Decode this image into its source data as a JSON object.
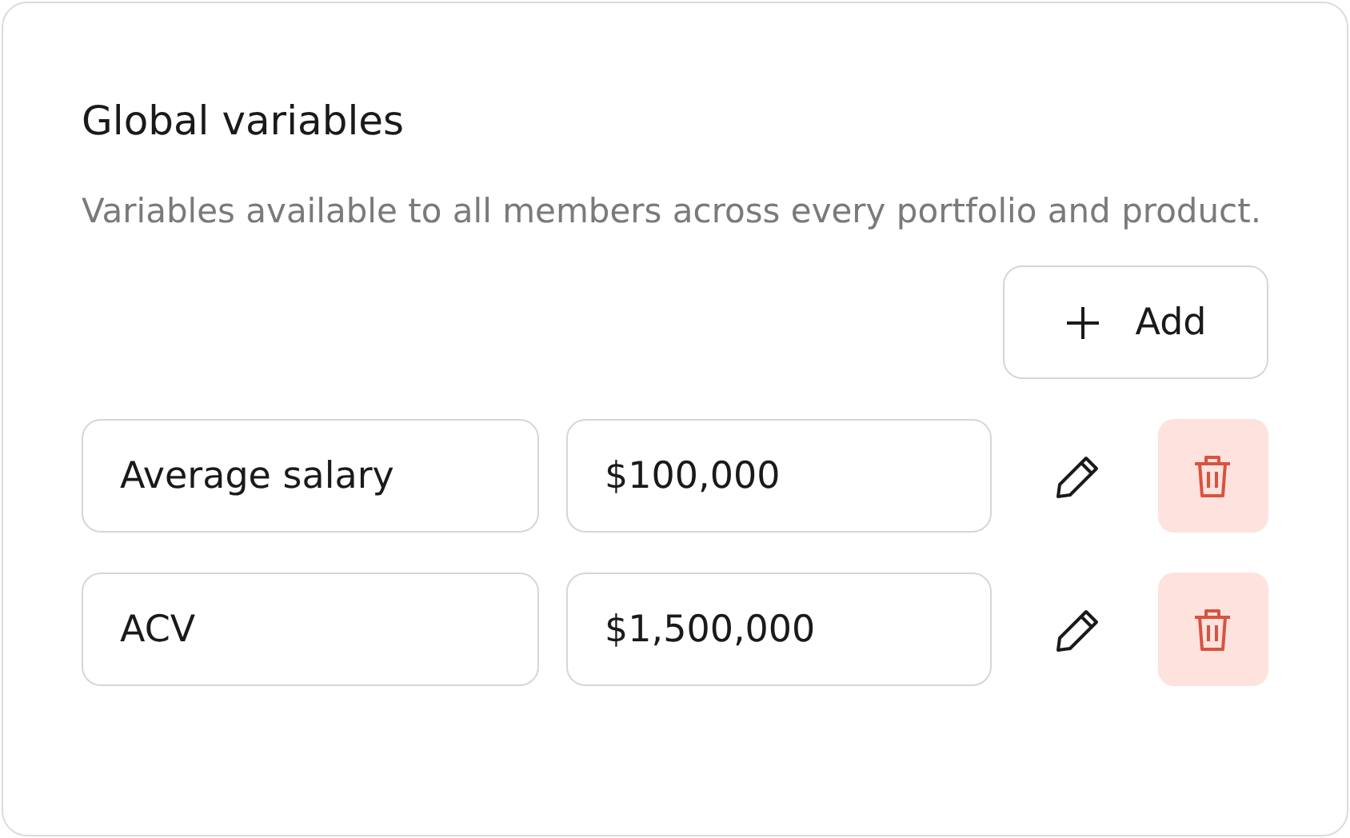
{
  "title": "Global variables",
  "description": "Variables available to all members across every portfolio and product.",
  "add_button": "Add",
  "variables": [
    {
      "name": "Average salary",
      "value": "$100,000"
    },
    {
      "name": "ACV",
      "value": "$1,500,000"
    }
  ]
}
